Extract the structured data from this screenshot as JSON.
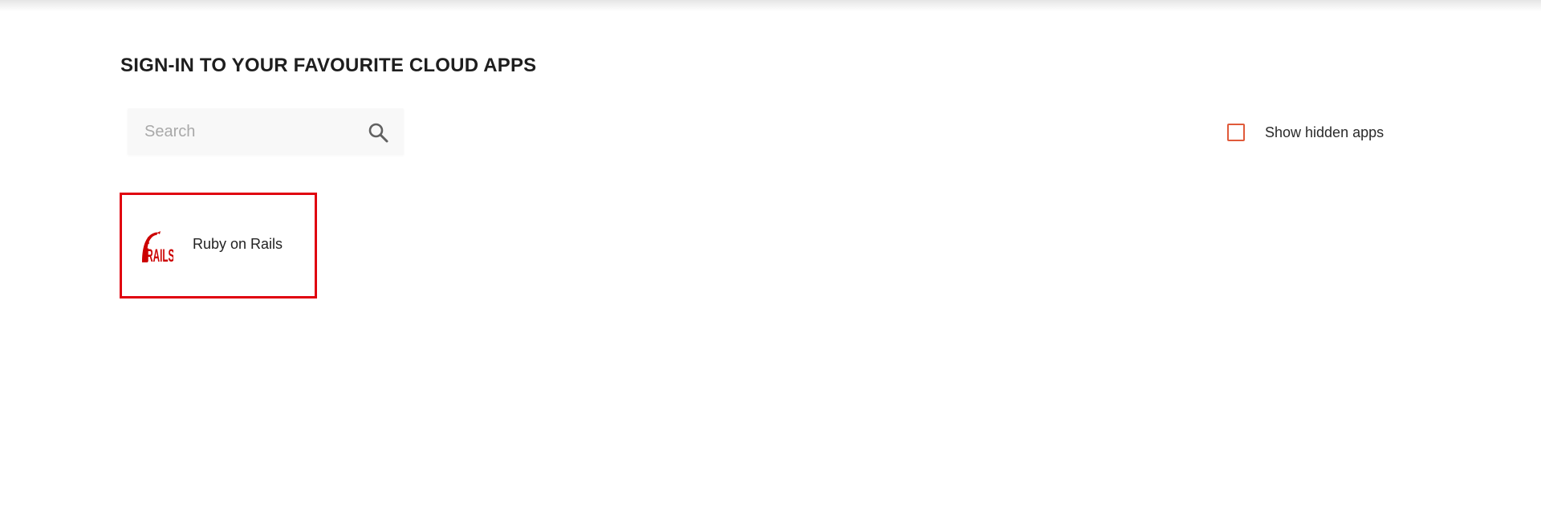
{
  "header": {
    "title": "SIGN-IN TO YOUR FAVOURITE CLOUD APPS"
  },
  "search": {
    "placeholder": "Search",
    "value": "",
    "icon": "search-icon"
  },
  "filters": {
    "show_hidden_label": "Show hidden apps",
    "show_hidden_checked": false
  },
  "apps": [
    {
      "name": "Ruby on Rails",
      "logo_text": "RAILS",
      "icon": "rails-logo-icon",
      "selected": true
    }
  ],
  "colors": {
    "accent": "#e05a3a",
    "tile_highlight": "#e0000f",
    "rails_red": "#cc0000",
    "search_bg": "#f8f8f8"
  }
}
